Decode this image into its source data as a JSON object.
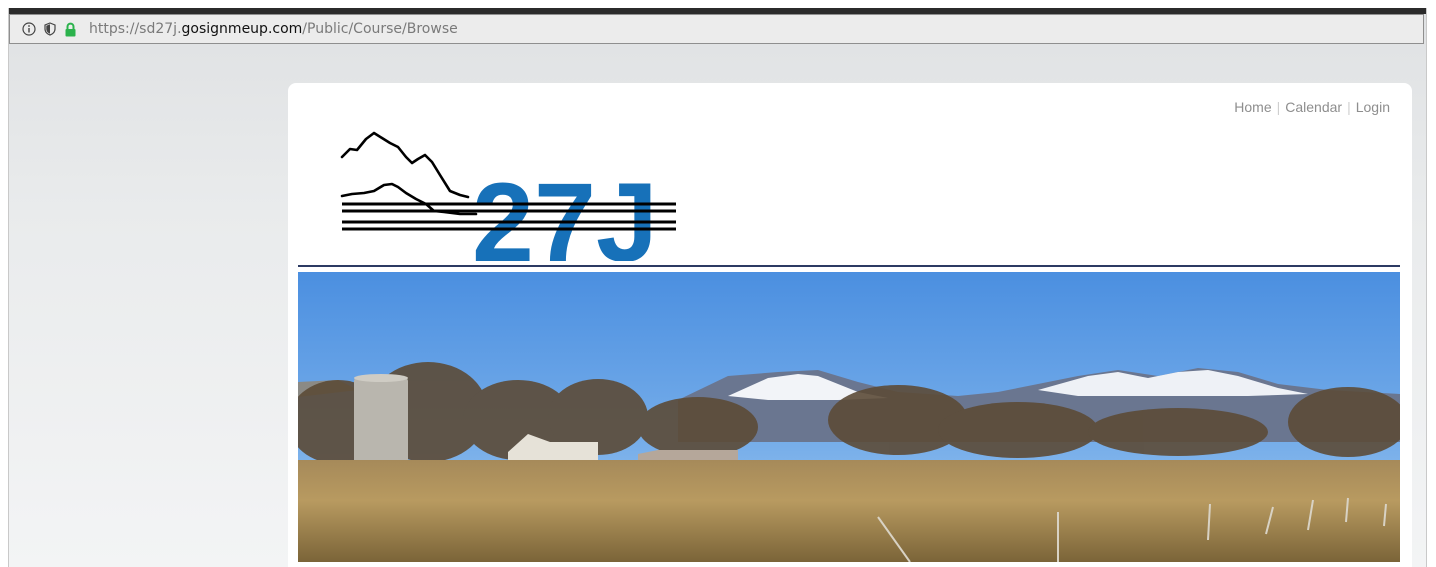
{
  "browser": {
    "url_prefix": "https://sd27j.",
    "url_domain": "gosignmeup.com",
    "url_path": "/Public/Course/Browse",
    "icons": [
      "info-icon",
      "shield-icon",
      "lock-icon"
    ],
    "lock_color": "#2bb24c"
  },
  "nav": {
    "home": "Home",
    "calendar": "Calendar",
    "login": "Login"
  },
  "logo": {
    "text": "27J",
    "brand_color": "#1771b9"
  },
  "colors": {
    "divider": "#2c3a63",
    "sky": "#5b9be0"
  }
}
